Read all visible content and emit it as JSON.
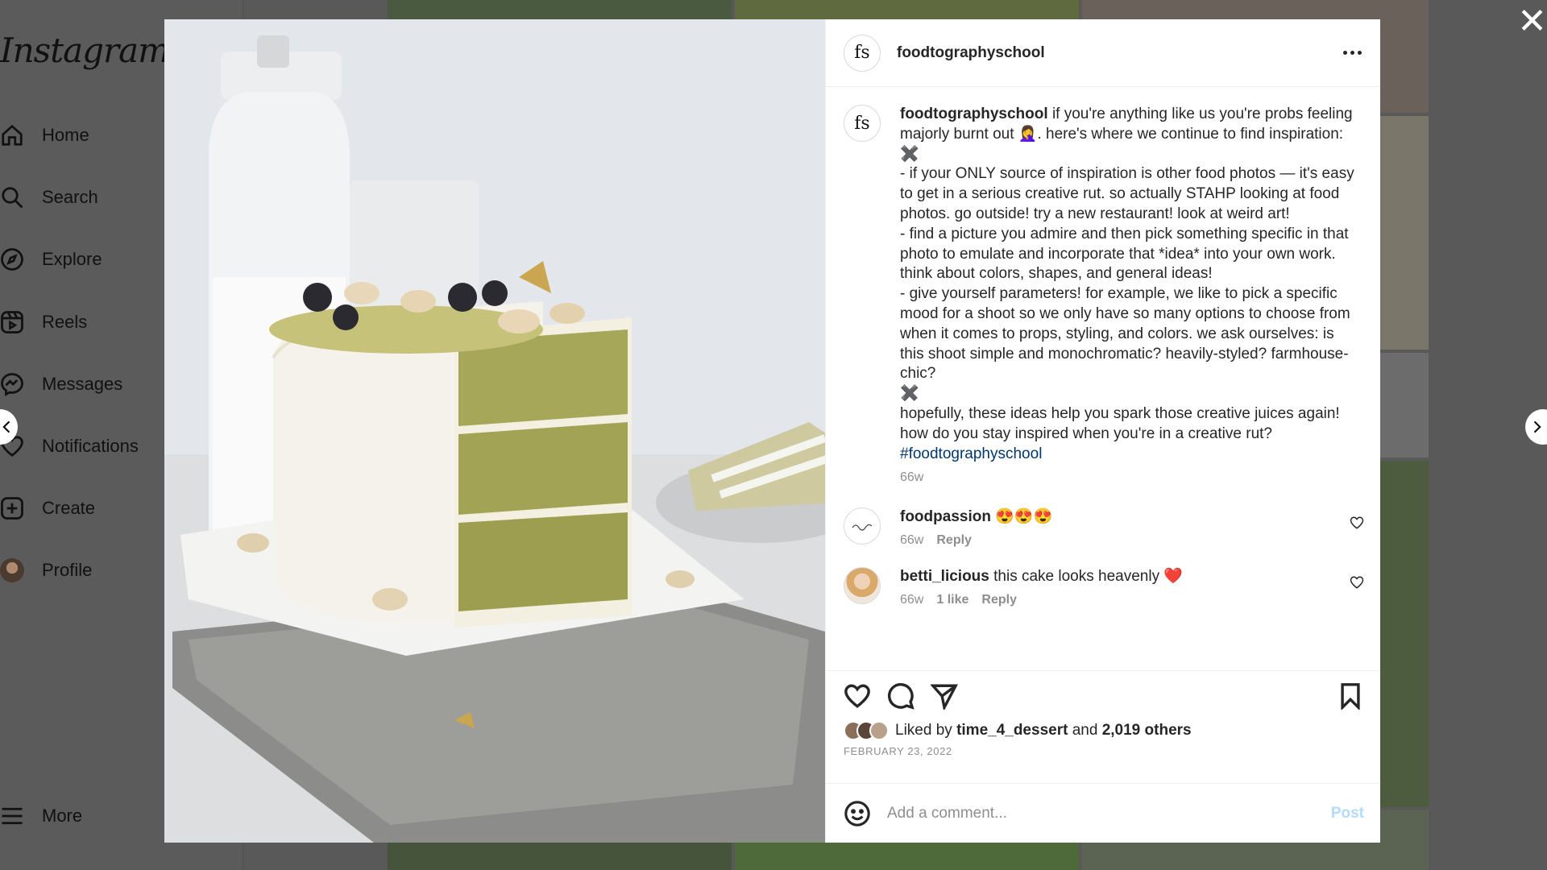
{
  "sidebar": {
    "logo": "Instagram",
    "items": [
      {
        "label": "Home",
        "icon": "home-icon"
      },
      {
        "label": "Search",
        "icon": "search-icon"
      },
      {
        "label": "Explore",
        "icon": "compass-icon"
      },
      {
        "label": "Reels",
        "icon": "reels-icon"
      },
      {
        "label": "Messages",
        "icon": "messenger-icon"
      },
      {
        "label": "Notifications",
        "icon": "heart-icon"
      },
      {
        "label": "Create",
        "icon": "plus-square-icon"
      },
      {
        "label": "Profile",
        "icon": "profile-avatar"
      }
    ],
    "more_label": "More"
  },
  "post": {
    "author": "foodtographyschool",
    "avatar_initials": "fs",
    "caption_lines": [
      "if you're anything like us you're probs feeling majorly burnt out 🤦‍♀️. here's where we continue to find inspiration:",
      "✖️",
      "- if your ONLY source of inspiration is other food photos — it's easy to get in a serious creative rut. so actually STAHP looking at food photos. go outside! try a new restaurant! look at weird art!",
      "- find a picture you admire and then pick something specific in that photo to emulate and incorporate that *idea* into your own work. think about colors, shapes, and general ideas!",
      "- give yourself parameters! for example, we like to pick a specific mood for a shoot so we only have so many options to choose from when it comes to props, styling, and colors. we ask ourselves: is this shoot simple and monochromatic? heavily-styled? farmhouse-chic?",
      "✖️",
      "hopefully, these ideas help you spark those creative juices again! how do you stay inspired when you're in a creative rut?"
    ],
    "hashtag": "#foodtographyschool",
    "age": "66w",
    "liked_by_prefix": "Liked by",
    "liked_by_user": "time_4_dessert",
    "liked_and": "and",
    "liked_others": "2,019 others",
    "date": "FEBRUARY 23, 2022"
  },
  "comments": [
    {
      "user": "foodpassion",
      "text": "😍😍😍",
      "age": "66w",
      "reply": "Reply",
      "likes": ""
    },
    {
      "user": "betti_licious",
      "text": "this cake looks heavenly ❤️",
      "age": "66w",
      "likes": "1 like",
      "reply": "Reply"
    }
  ],
  "composer": {
    "placeholder": "Add a comment...",
    "post_label": "Post"
  },
  "colors": {
    "link": "#00376b",
    "post_disabled": "#b3dbff",
    "muted": "#8e8e8e"
  }
}
